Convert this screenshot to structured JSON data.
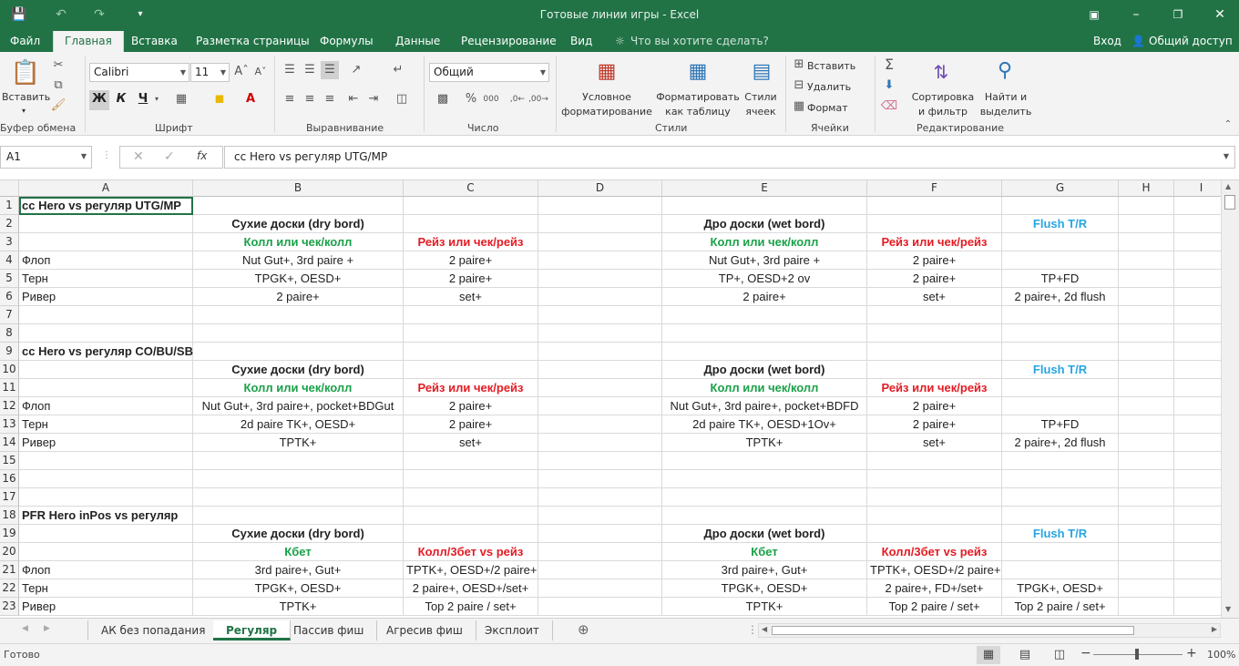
{
  "window": {
    "title": "Готовые линии игры - Excel"
  },
  "menu": {
    "items": [
      "Файл",
      "Главная",
      "Вставка",
      "Разметка страницы",
      "Формулы",
      "Данные",
      "Рецензирование",
      "Вид"
    ],
    "active": "Главная",
    "tellme": "Что вы хотите сделать?",
    "signin": "Вход",
    "share": "Общий доступ"
  },
  "ribbon": {
    "paste": "Вставить",
    "clipboard_label": "Буфер обмена",
    "font_name": "Calibri",
    "font_size": "11",
    "bold": "Ж",
    "italic": "К",
    "underline": "Ч",
    "font_label": "Шрифт",
    "align_label": "Выравнивание",
    "number_format": "Общий",
    "number_label": "Число",
    "cond_format_1": "Условное",
    "cond_format_2": "форматирование",
    "format_table_1": "Форматировать",
    "format_table_2": "как таблицу",
    "cell_styles_1": "Стили",
    "cell_styles_2": "ячеек",
    "styles_label": "Стили",
    "insert": "Вставить",
    "delete": "Удалить",
    "format": "Формат",
    "cells_label": "Ячейки",
    "sort_1": "Сортировка",
    "sort_2": "и фильтр",
    "find_1": "Найти и",
    "find_2": "выделить",
    "editing_label": "Редактирование"
  },
  "formula_bar": {
    "name_box": "A1",
    "formula": "cc Hero vs регуляр UTG/MP"
  },
  "columns": [
    "A",
    "B",
    "C",
    "D",
    "E",
    "F",
    "G",
    "H",
    "I"
  ],
  "rows": [
    {
      "n": "1",
      "A": "cc Hero vs регуляр UTG/MP"
    },
    {
      "n": "2",
      "B": "Сухие доски (dry bord)",
      "E": "Дро доски (wet bord)",
      "G": "Flush T/R"
    },
    {
      "n": "3",
      "B": "Колл или чек/колл",
      "C": "Рейз или чек/рейз",
      "E": "Колл или чек/колл",
      "F": "Рейз или чек/рейз"
    },
    {
      "n": "4",
      "A": "Флоп",
      "B": "Nut Gut+, 3rd paire +",
      "C": "2 paire+",
      "E": "Nut Gut+, 3rd paire +",
      "F": "2 paire+"
    },
    {
      "n": "5",
      "A": "Терн",
      "B": "TPGK+, OESD+",
      "C": "2 paire+",
      "E": "TP+, OESD+2 ov",
      "F": "2 paire+",
      "G": "TP+FD"
    },
    {
      "n": "6",
      "A": "Ривер",
      "B": "2 paire+",
      "C": "set+",
      "E": "2 paire+",
      "F": "set+",
      "G": "2 paire+, 2d flush"
    },
    {
      "n": "7"
    },
    {
      "n": "8"
    },
    {
      "n": "9",
      "A": "cc Hero vs регуляр CO/BU/SB"
    },
    {
      "n": "10",
      "B": "Сухие доски (dry bord)",
      "E": "Дро доски (wet bord)",
      "G": "Flush T/R"
    },
    {
      "n": "11",
      "B": "Колл или чек/колл",
      "C": "Рейз или чек/рейз",
      "E": "Колл или чек/колл",
      "F": "Рейз или чек/рейз"
    },
    {
      "n": "12",
      "A": "Флоп",
      "B": "Nut Gut+, 3rd paire+, pocket+BDGut",
      "C": "2 paire+",
      "E": "Nut Gut+, 3rd paire+, pocket+BDFD",
      "F": "2 paire+"
    },
    {
      "n": "13",
      "A": "Терн",
      "B": "2d paire TK+, OESD+",
      "C": "2 paire+",
      "E": "2d paire TK+, OESD+1Ov+",
      "F": "2 paire+",
      "G": "TP+FD"
    },
    {
      "n": "14",
      "A": "Ривер",
      "B": "TPTK+",
      "C": "set+",
      "E": "TPTK+",
      "F": "set+",
      "G": "2 paire+, 2d flush"
    },
    {
      "n": "15"
    },
    {
      "n": "16"
    },
    {
      "n": "17"
    },
    {
      "n": "18",
      "A": "PFR Hero inPos vs регуляр"
    },
    {
      "n": "19",
      "B": "Сухие доски (dry bord)",
      "E": "Дро доски (wet bord)",
      "G": "Flush T/R"
    },
    {
      "n": "20",
      "B": "Кбет",
      "C": "Колл/3бет vs рейз",
      "E": "Кбет",
      "F": "Колл/3бет vs рейз"
    },
    {
      "n": "21",
      "A": "Флоп",
      "B": "3rd paire+, Gut+",
      "C": "TPTK+, OESD+/2 paire+",
      "E": "3rd paire+, Gut+",
      "F": "TPTK+, OESD+/2 paire+"
    },
    {
      "n": "22",
      "A": "Терн",
      "B": "TPGK+, OESD+",
      "C": "2 paire+, OESD+/set+",
      "E": "TPGK+, OESD+",
      "F": "2 paire+, FD+/set+",
      "G": "TPGK+, OESD+"
    },
    {
      "n": "23",
      "A": "Ривер",
      "B": "TPTK+",
      "C": "Top 2 paire / set+",
      "E": "TPTK+",
      "F": "Top 2 paire / set+",
      "G": "Top 2 paire / set+"
    }
  ],
  "sheets": [
    "АК без попадания",
    "Регуляр",
    "Пассив фиш",
    "Агресив фиш",
    "Эксплоит"
  ],
  "active_sheet": "Регуляр",
  "status": {
    "ready": "Готово",
    "zoom": "100%"
  },
  "colors": {
    "excel_green": "#217346",
    "text_green": "#1aa148",
    "text_red": "#e31b23",
    "text_blue": "#27a5e0"
  }
}
